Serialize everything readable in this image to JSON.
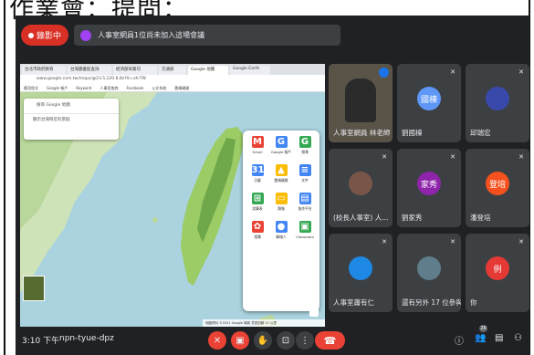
{
  "doc": {
    "title": "作業會：提問："
  },
  "meet": {
    "recording_label": "錄影中",
    "notice": "人事室網員1位尚未加入這場會議",
    "clock": "3:10 下午",
    "meeting_code": "npn-tyue-dpz",
    "participant_count": "26"
  },
  "screen": {
    "tabs": [
      "台北市政府教育",
      "台灣圖書館查詢",
      "經濟部商業司",
      "交通部",
      "Google 地圖",
      "Google Earth"
    ],
    "address": "www.google.com.tw/maps/@23.5,120.8,8z?hl=zh-TW",
    "bookmarks": [
      "應用程式",
      "Google 帳戶",
      "Keyword",
      "人事室查詢",
      "Facebook",
      "公文系統",
      "雲端硬碟"
    ],
    "search_placeholder": "搜尋 Google 地圖",
    "search_row2": "顯示台灣附近的景點",
    "apps": [
      {
        "label": "Gmail",
        "letter": "M",
        "color": "#ea4335"
      },
      {
        "label": "Google 帳戶",
        "letter": "G",
        "color": "#4285f4"
      },
      {
        "label": "搜尋",
        "letter": "G",
        "color": "#34a853"
      },
      {
        "label": "日曆",
        "letter": "31",
        "color": "#4285f4"
      },
      {
        "label": "雲端硬碟",
        "letter": "▲",
        "color": "#fbbc04"
      },
      {
        "label": "文件",
        "letter": "≡",
        "color": "#4285f4"
      },
      {
        "label": "試算表",
        "letter": "⊞",
        "color": "#34a853"
      },
      {
        "label": "簡報",
        "letter": "▭",
        "color": "#fbbc04"
      },
      {
        "label": "協作平台",
        "letter": "▤",
        "color": "#4285f4"
      },
      {
        "label": "相簿",
        "letter": "✿",
        "color": "#ea4335"
      },
      {
        "label": "聯絡人",
        "letter": "●",
        "color": "#4285f4"
      },
      {
        "label": "Classroom",
        "letter": "▣",
        "color": "#34a853"
      }
    ],
    "map_footer": "地圖資料 ©2021 Google 條款 意見回饋 10 公里"
  },
  "tiles": [
    {
      "name": "人事室網員 林老師",
      "avatar": "",
      "avatar_color": "#000000",
      "speaking": true
    },
    {
      "name": "劉國棟",
      "avatar": "國棟",
      "avatar_color": "#5e97f6"
    },
    {
      "name": "邱瑞宏",
      "avatar": "",
      "avatar_color": "#3949ab"
    },
    {
      "name": "(校長人事室) 人...",
      "avatar": "",
      "avatar_color": "#795548"
    },
    {
      "name": "劉家秀",
      "avatar": "家秀",
      "avatar_color": "#8e24aa"
    },
    {
      "name": "潘登培",
      "avatar": "登培",
      "avatar_color": "#f4511e"
    },
    {
      "name": "人事室蕭有仁",
      "avatar": "",
      "avatar_color": "#1e88e5"
    },
    {
      "name": "還有另外 17 位參與者",
      "avatar": "",
      "avatar_color": "#607d8b"
    },
    {
      "name": "你",
      "avatar": "例",
      "avatar_color": "#e53935"
    }
  ],
  "colors": {
    "meet_bg": "#202124",
    "tile_bg": "#3c4043",
    "red": "#ea4335"
  }
}
